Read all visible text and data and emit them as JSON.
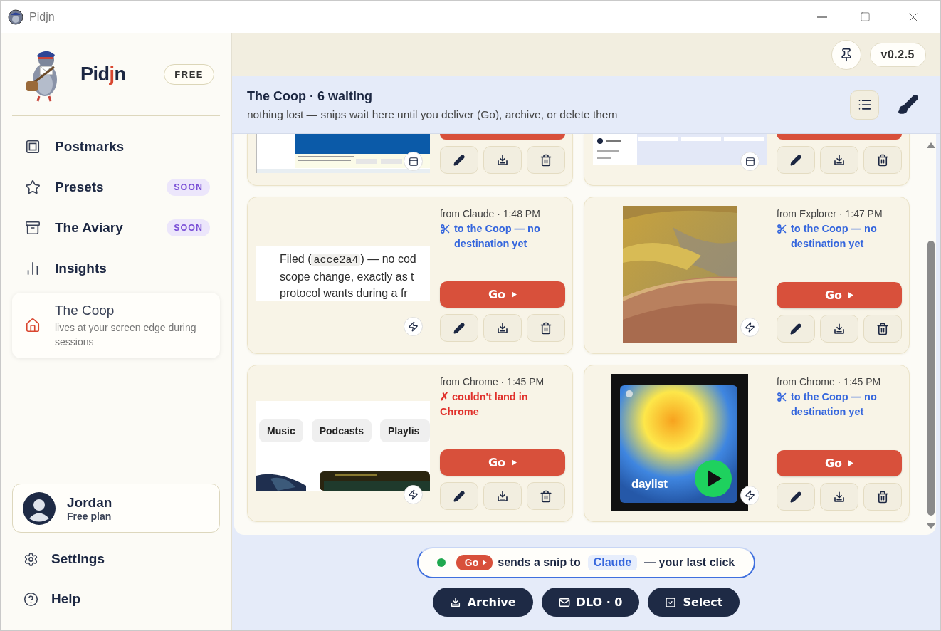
{
  "window": {
    "title": "Pidjn"
  },
  "sidebar": {
    "brand": {
      "parts": [
        {
          "text": "Pid",
          "accent": false
        },
        {
          "text": "j",
          "accent": true
        },
        {
          "text": "n",
          "accent": false
        }
      ]
    },
    "plan_badge": "FREE",
    "nav": [
      {
        "kind": "postmarks",
        "label": "Postmarks",
        "selected": false
      },
      {
        "kind": "presets",
        "label": "Presets",
        "badge": "SOON",
        "selected": false
      },
      {
        "kind": "aviary",
        "label": "The Aviary",
        "badge": "SOON",
        "selected": false
      },
      {
        "kind": "insights",
        "label": "Insights",
        "selected": false
      },
      {
        "kind": "coop",
        "label": "The Coop",
        "subtitle": "lives at your screen edge during sessions",
        "selected": true
      }
    ],
    "user": {
      "name": "Jordan",
      "plan": "Free plan"
    },
    "footer": [
      {
        "kind": "settings",
        "label": "Settings"
      },
      {
        "kind": "help",
        "label": "Help"
      }
    ]
  },
  "topbar": {
    "version": "v0.2.5"
  },
  "header": {
    "title": "The Coop · 6 waiting",
    "subtitle": "nothing lost — snips wait here until you deliver (Go), archive, or delete them"
  },
  "cards": [
    {
      "kind": "cut",
      "thumb": {
        "kind": "doc"
      }
    },
    {
      "kind": "cut",
      "thumb": {
        "kind": "app"
      }
    },
    {
      "kind": "full",
      "source": "from Claude · 1:48 PM",
      "status": {
        "kind": "coop",
        "text": "to the Coop — no destination yet"
      },
      "go": "Go",
      "thumb": {
        "kind": "text",
        "lines": [
          {
            "before": "Filed (",
            "code": "acce2a4",
            "after": ") — no cod"
          },
          {
            "before": "scope change, exactly as t"
          },
          {
            "before": "protocol wants during a fr"
          }
        ]
      }
    },
    {
      "kind": "full",
      "source": "from Explorer · 1:47 PM",
      "status": {
        "kind": "coop",
        "text": "to the Coop — no destination yet"
      },
      "go": "Go"
    },
    {
      "kind": "full",
      "source": "from Chrome · 1:45 PM",
      "status": {
        "kind": "failed",
        "text": "✗ couldn't land in Chrome"
      },
      "go": "Go",
      "thumb": {
        "kind": "chips",
        "chips": [
          "Music",
          "Podcasts",
          "Playlis"
        ]
      }
    },
    {
      "kind": "full",
      "source": "from Chrome · 1:45 PM",
      "status": {
        "kind": "coop",
        "text": "to the Coop — no destination yet"
      },
      "go": "Go",
      "thumb": {
        "kind": "album",
        "label": "daylist"
      }
    }
  ],
  "hint": {
    "go": "Go",
    "before": "sends a snip to",
    "target": "Claude",
    "after": "— your last click"
  },
  "actions": [
    {
      "kind": "archive",
      "label": "Archive"
    },
    {
      "kind": "dlo",
      "label": "DLO · 0"
    },
    {
      "kind": "select",
      "label": "Select"
    }
  ]
}
